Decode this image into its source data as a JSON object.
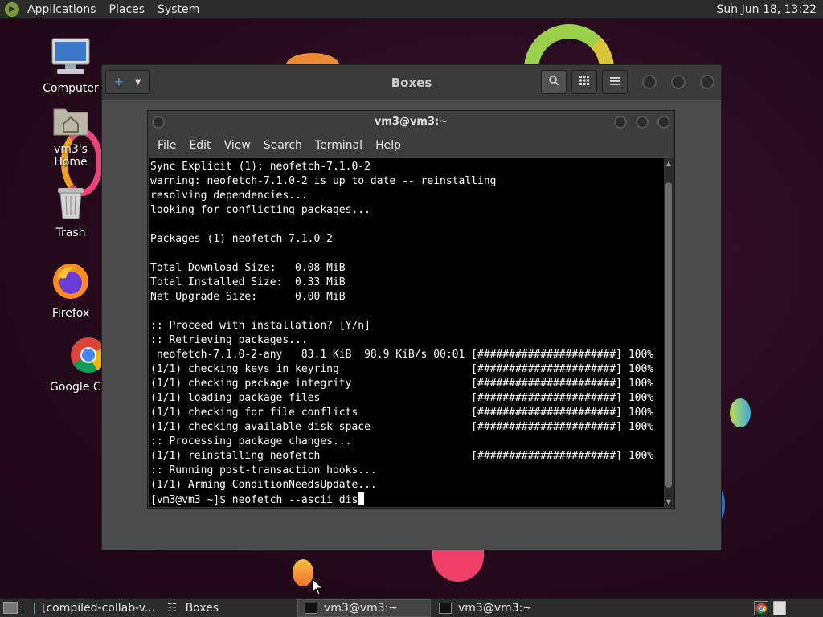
{
  "top_panel": {
    "menus": [
      "Applications",
      "Places",
      "System"
    ],
    "clock": "Sun Jun 18, 13:22"
  },
  "desktop_icons": [
    {
      "label": "Computer",
      "icon": "computer-icon"
    },
    {
      "label": "vm3's Home",
      "icon": "home-folder-icon"
    },
    {
      "label": "Trash",
      "icon": "trash-icon"
    },
    {
      "label": "Firefox",
      "icon": "firefox-icon"
    },
    {
      "label": "Google Chrome",
      "icon": "chrome-icon"
    }
  ],
  "boxes_window": {
    "title": "Boxes",
    "new_button_icon": "plus-icon",
    "buttons": [
      "search-icon",
      "grid-view-icon",
      "hamburger-menu-icon"
    ]
  },
  "terminal": {
    "title": "vm3@vm3:~",
    "menus": [
      "File",
      "Edit",
      "View",
      "Search",
      "Terminal",
      "Help"
    ],
    "lines": [
      "Sync Explicit (1): neofetch-7.1.0-2",
      "warning: neofetch-7.1.0-2 is up to date -- reinstalling",
      "resolving dependencies...",
      "looking for conflicting packages...",
      "",
      "Packages (1) neofetch-7.1.0-2",
      "",
      "Total Download Size:   0.08 MiB",
      "Total Installed Size:  0.33 MiB",
      "Net Upgrade Size:      0.00 MiB",
      "",
      ":: Proceed with installation? [Y/n]",
      ":: Retrieving packages...",
      " neofetch-7.1.0-2-any   83.1 KiB  98.9 KiB/s 00:01 [######################] 100%",
      "(1/1) checking keys in keyring                     [######################] 100%",
      "(1/1) checking package integrity                   [######################] 100%",
      "(1/1) loading package files                        [######################] 100%",
      "(1/1) checking for file conflicts                  [######################] 100%",
      "(1/1) checking available disk space                [######################] 100%",
      ":: Processing package changes...",
      "(1/1) reinstalling neofetch                        [######################] 100%",
      ":: Running post-transaction hooks...",
      "(1/1) Arming ConditionNeedsUpdate..."
    ],
    "prompt": "[vm3@vm3 ~]$ ",
    "command": "neofetch --ascii_dis"
  },
  "taskbar": {
    "tasks": [
      {
        "label": "[compiled-collab-v...",
        "icon": "files-icon",
        "active": false
      },
      {
        "label": "Boxes",
        "icon": "boxes-icon",
        "active": false
      },
      {
        "label": "vm3@vm3:~",
        "icon": "terminal-icon",
        "active": true
      },
      {
        "label": "vm3@vm3:~",
        "icon": "terminal-icon",
        "active": false
      }
    ]
  },
  "colors": {
    "panel": "#2b2b2b",
    "wallpaper": "#2a0c20",
    "terminal_bg": "#000000",
    "window_bg": "#4b4b4b"
  }
}
